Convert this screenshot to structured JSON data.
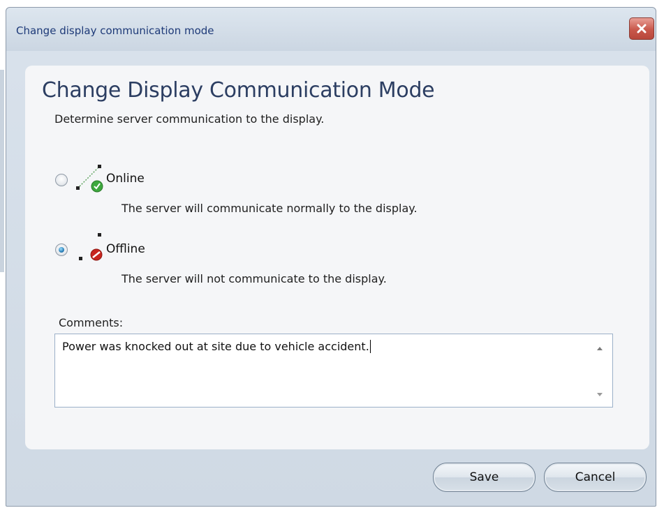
{
  "window": {
    "title": "Change display communication mode"
  },
  "header": {
    "heading": "Change Display Communication Mode",
    "subheading": "Determine server communication to the display."
  },
  "options": [
    {
      "label": "Online",
      "description": "The server will communicate normally to the display.",
      "selected": false,
      "icon": "connection-online-icon"
    },
    {
      "label": "Offline",
      "description": "The server will not communicate to the display.",
      "selected": true,
      "icon": "connection-offline-icon"
    }
  ],
  "comments": {
    "label": "Comments:",
    "value": "Power was knocked out at site due to vehicle accident."
  },
  "buttons": {
    "save": "Save",
    "cancel": "Cancel"
  },
  "colors": {
    "title_text": "#1e3a78",
    "close_button": "#c9584b",
    "online_check": "#3ea83e",
    "offline_stop": "#c8251f"
  }
}
